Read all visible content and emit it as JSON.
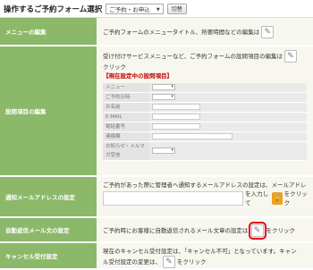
{
  "header": {
    "title": "操作するご予約フォーム選択",
    "form_select": "ご予約・お申込",
    "switch_button": "切替"
  },
  "rows": {
    "menu": {
      "label": "メニューの編集",
      "text": "ご予約フォームのメニュータイトル、所要時間などの編集は"
    },
    "settings": {
      "label": "設問項目の編集",
      "text_a": "受け付けサービスメニューなど、ご予約フォームの設問項目の編集は",
      "text_b": "クリック",
      "current_heading": "【現在設定中の設問項目】",
      "fields": [
        {
          "key": "メニュー"
        },
        {
          "key": "ご予約日時"
        },
        {
          "key": "お名前"
        },
        {
          "key": "E-MAIL"
        },
        {
          "key": "電話番号"
        },
        {
          "key": "連絡欄"
        },
        {
          "key": "お知らせ・メルマガ受信"
        }
      ]
    },
    "notify": {
      "label": "通知メールアドレスの設定",
      "text": "ご予約があった際に管理者へ通知するメールアドレスの設定は、メールアドレ",
      "text_b": "を入力して",
      "click": "をクリック"
    },
    "auto": {
      "label": "自動返信メール文の設定",
      "text": "ご予約時にお客様に自動返信されるメール文章の設定は",
      "click": "をクリック"
    },
    "cancel": {
      "label": "キャンセル受付設定",
      "text_a": "現在のキャンセル受付設定は、「キャンセル不可」となっています。キャン",
      "text_b": "ル受付設定の変更は、",
      "click": "をクリック"
    }
  }
}
